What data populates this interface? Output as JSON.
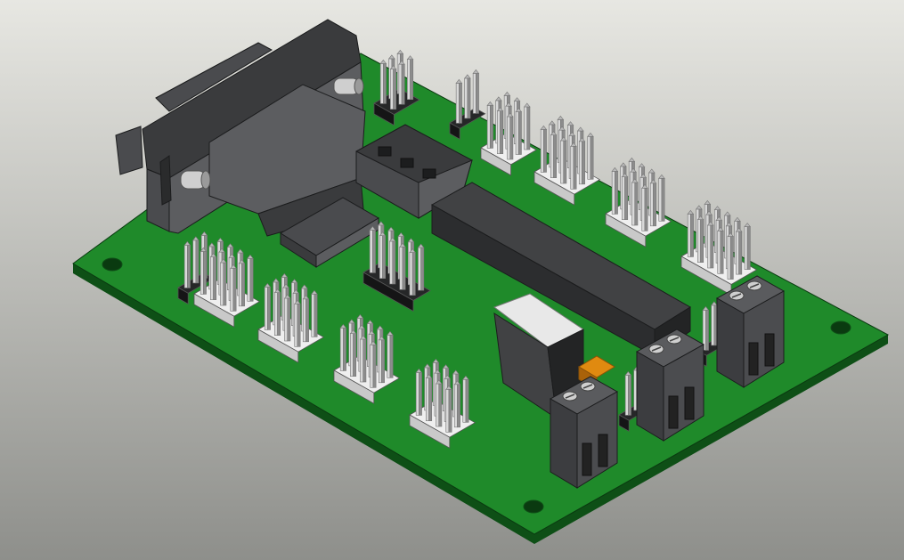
{
  "scene": {
    "subject": "pcb-board-3d",
    "colors": {
      "bg_top": "#e7e7e2",
      "bg_bottom": "#8e8f8b",
      "pcb_top": "#1f8a2a",
      "pcb_side": "#0e4f16",
      "pcb_edge": "#0a3a10",
      "connector_dark": "#3a3b3d",
      "connector_mid": "#4a4b4e",
      "connector_light": "#5c5d60",
      "ic_top": "#414244",
      "ic_side": "#2c2d2f",
      "pin_light": "#d9d9d9",
      "pin_mid": "#b9b9b9",
      "pin_dark": "#8c8c8c",
      "header_base": "#efefef",
      "header_side": "#c9c9c9",
      "header_black": "#262728",
      "screw_metal": "#cfcfcf",
      "terminal_block": "#4b4c4f",
      "capacitor": "#e08a10",
      "regulator_tab": "#e8e8e8"
    },
    "icons": [
      "hole-icon",
      "db9-connector-icon",
      "dip-ic-icon",
      "pin-header-icon",
      "terminal-block-icon"
    ]
  }
}
